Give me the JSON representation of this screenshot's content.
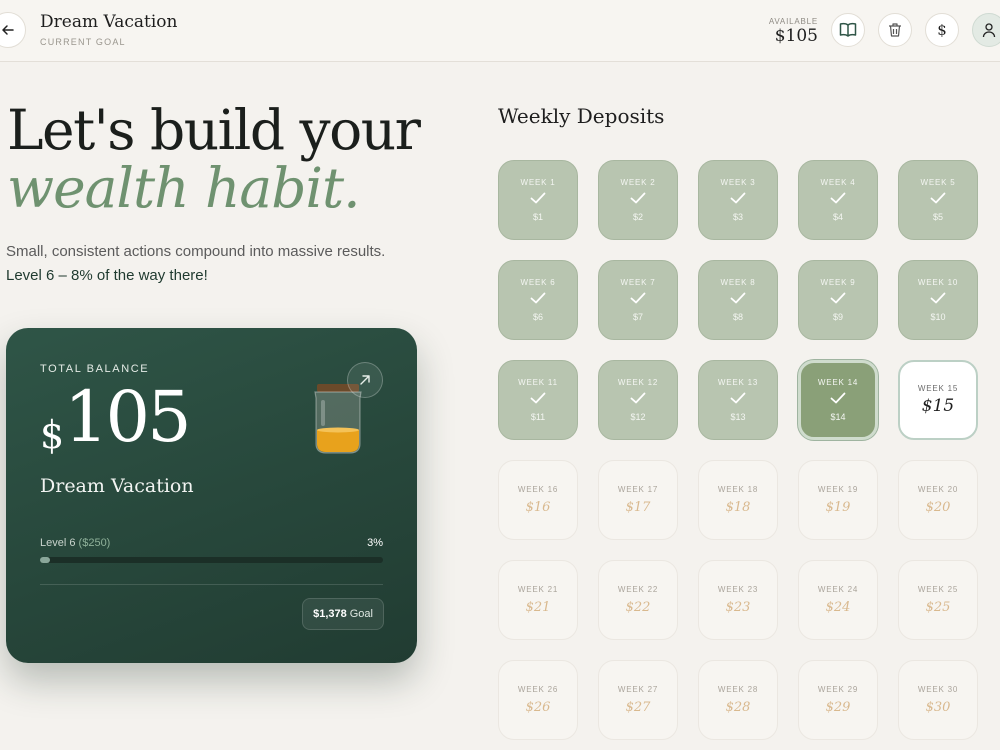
{
  "header": {
    "title": "Dream Vacation",
    "subtitle": "CURRENT GOAL",
    "available_label": "AVAILABLE",
    "available_value": "$105",
    "dollar_glyph": "$",
    "icons": [
      "back-arrow-icon",
      "book-icon",
      "trash-icon",
      "dollar-icon",
      "user-icon"
    ]
  },
  "hero": {
    "line1": "Let's build your",
    "line2": "wealth habit.",
    "desc_plain": "Small, consistent actions compound into massive results. ",
    "desc_highlight": "Level 6 – 8% of the way there!"
  },
  "card": {
    "label": "TOTAL BALANCE",
    "currency": "$",
    "amount": "105",
    "goal_name": "Dream Vacation",
    "level_text": "Level 6",
    "level_target": "($250)",
    "percent_text": "3%",
    "progress_fraction": 0.03,
    "goal_amount": "$1,378",
    "goal_word": "Goal",
    "accent_color": "#2f5547"
  },
  "deposits": {
    "title": "Weekly Deposits",
    "weeks": [
      {
        "label": "WEEK 1",
        "amount": "$1",
        "state": "done"
      },
      {
        "label": "WEEK 2",
        "amount": "$2",
        "state": "done"
      },
      {
        "label": "WEEK 3",
        "amount": "$3",
        "state": "done"
      },
      {
        "label": "WEEK 4",
        "amount": "$4",
        "state": "done"
      },
      {
        "label": "WEEK 5",
        "amount": "$5",
        "state": "done"
      },
      {
        "label": "WEEK 6",
        "amount": "$6",
        "state": "done"
      },
      {
        "label": "WEEK 7",
        "amount": "$7",
        "state": "done"
      },
      {
        "label": "WEEK 8",
        "amount": "$8",
        "state": "done"
      },
      {
        "label": "WEEK 9",
        "amount": "$9",
        "state": "done"
      },
      {
        "label": "WEEK 10",
        "amount": "$10",
        "state": "done"
      },
      {
        "label": "WEEK 11",
        "amount": "$11",
        "state": "done"
      },
      {
        "label": "WEEK 12",
        "amount": "$12",
        "state": "done"
      },
      {
        "label": "WEEK 13",
        "amount": "$13",
        "state": "done"
      },
      {
        "label": "WEEK 14",
        "amount": "$14",
        "state": "current"
      },
      {
        "label": "WEEK 15",
        "amount": "$15",
        "state": "next"
      },
      {
        "label": "WEEK 16",
        "amount": "$16",
        "state": "future"
      },
      {
        "label": "WEEK 17",
        "amount": "$17",
        "state": "future"
      },
      {
        "label": "WEEK 18",
        "amount": "$18",
        "state": "future"
      },
      {
        "label": "WEEK 19",
        "amount": "$19",
        "state": "future"
      },
      {
        "label": "WEEK 20",
        "amount": "$20",
        "state": "future"
      },
      {
        "label": "WEEK 21",
        "amount": "$21",
        "state": "future"
      },
      {
        "label": "WEEK 22",
        "amount": "$22",
        "state": "future"
      },
      {
        "label": "WEEK 23",
        "amount": "$23",
        "state": "future"
      },
      {
        "label": "WEEK 24",
        "amount": "$24",
        "state": "future"
      },
      {
        "label": "WEEK 25",
        "amount": "$25",
        "state": "future"
      },
      {
        "label": "WEEK 26",
        "amount": "$26",
        "state": "future"
      },
      {
        "label": "WEEK 27",
        "amount": "$27",
        "state": "future"
      },
      {
        "label": "WEEK 28",
        "amount": "$28",
        "state": "future"
      },
      {
        "label": "WEEK 29",
        "amount": "$29",
        "state": "future"
      },
      {
        "label": "WEEK 30",
        "amount": "$30",
        "state": "future"
      }
    ]
  }
}
